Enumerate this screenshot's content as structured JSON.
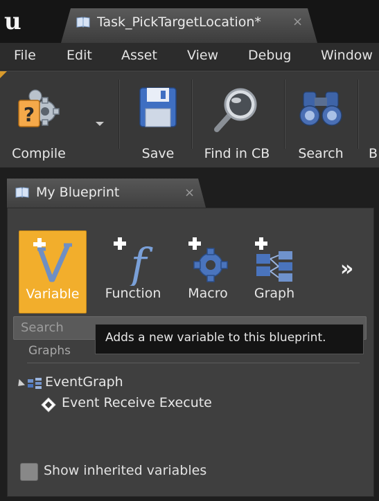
{
  "window": {
    "tab_title": "Task_PickTargetLocation*",
    "tab_close": "×"
  },
  "menu": {
    "items": [
      "File",
      "Edit",
      "Asset",
      "View",
      "Debug",
      "Window"
    ]
  },
  "toolbar": {
    "buttons": [
      {
        "label": "Compile",
        "icon": "compile-icon"
      },
      {
        "label": "Save",
        "icon": "save-icon"
      },
      {
        "label": "Find in CB",
        "icon": "find-in-cb-icon"
      },
      {
        "label": "Search",
        "icon": "search-icon"
      },
      {
        "label": "B",
        "icon": "truncated-button"
      }
    ]
  },
  "panel": {
    "tab_title": "My Blueprint",
    "tab_close": "×",
    "add_buttons": [
      {
        "label": "Variable",
        "icon": "add-variable-icon",
        "active": true
      },
      {
        "label": "Function",
        "icon": "add-function-icon",
        "active": false
      },
      {
        "label": "Macro",
        "icon": "add-macro-icon",
        "active": false
      },
      {
        "label": "Graph",
        "icon": "add-graph-icon",
        "active": false
      }
    ],
    "overflow": "»",
    "search_placeholder": "Search",
    "section_graphs": "Graphs",
    "tooltip": "Adds a new variable to this blueprint.",
    "tree": {
      "graph_label": "EventGraph",
      "event_label": "Event Receive Execute"
    },
    "show_inherited": {
      "label": "Show inherited variables",
      "checked": false
    }
  },
  "colors": {
    "accent_active": "#f2ae2c",
    "panel_bg": "#3f3f3f",
    "toolbar_bg": "#383838"
  }
}
